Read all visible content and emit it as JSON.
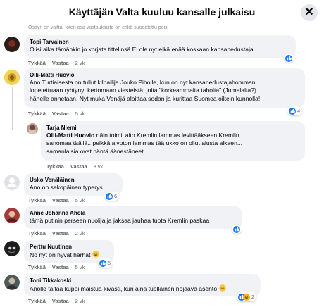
{
  "header": {
    "title": "Käyttäjän Valta kuuluu kansalle julkaisu",
    "close_icon": "close-icon"
  },
  "notice": "Osavn on vaitta, joten osa vastauksista on erikä suodatettu pois.",
  "actions": {
    "like": "Tykkää",
    "reply": "Vastaa"
  },
  "colors": {
    "bubble": "#f0f2f5",
    "like_blue": "#1877f2",
    "haha_yellow": "#f7b125",
    "meta": "#65676b"
  },
  "comments": [
    {
      "author": "Topi Tarvainen",
      "lines": [
        "Olisi aika tämänkin jo korjata tittelinsä.Ei ole nyt eikä enää koskaan kansanedustaja."
      ],
      "time": "2 vk",
      "reactions": {
        "count": ""
      }
    },
    {
      "author": "Olli-Matti Huovio",
      "lines": [
        "Ano Turtiaisesta on tullut kilpailija Jouko Piholle, kun on nyt kansanedustajahomman",
        "lopetettuaan ryhtynyt kertomaan viesteistä, joita \"korkeammalta taholta\" (Jumalalta?)",
        "hänelle annetaan. Nyt muka Venäjä aloittaa sodan ja kurittaa Suomea oikein kunnolla!"
      ],
      "time": "5 vk",
      "reactions": {
        "count": "4"
      }
    },
    {
      "author": "Tarja Niemi",
      "mention": "Olli-Matti Huovio",
      "lines": [
        " näin toimii aito Kremlin lammas levittääkseen Kremlin",
        "sanomaa täällä.. pelkkä aivoton lammas tää ukko on ollut alusta alkaen...",
        "samanlaisia ovat häntä äänestäneet"
      ],
      "time": "3 vk"
    },
    {
      "author": "Usko Venäläinen",
      "lines": [
        "Ano on sekopäinen typerys.."
      ],
      "time": "5 vk",
      "reactions": {
        "count": "6"
      }
    },
    {
      "author": "Anne Johanna Ahola",
      "lines": [
        "tämä putinin perseen nuolija ja jaksaa jauhaa tuota Kremlin paskaa"
      ],
      "time": "2 vk",
      "reactions": {
        "count": ""
      }
    },
    {
      "author": "Perttu Nuutinen",
      "lines": [
        "No nyt on hyvät harhat"
      ],
      "time": "5 vk",
      "reactions": {
        "count": "5"
      }
    },
    {
      "author": "Toni Tikkakoski",
      "lines": [
        "Anolle taitaa kuppi maistua kivasti, kun aina tuollainen nojaava asento"
      ],
      "time": "2 vk",
      "reactions": {
        "count": "2"
      }
    }
  ]
}
